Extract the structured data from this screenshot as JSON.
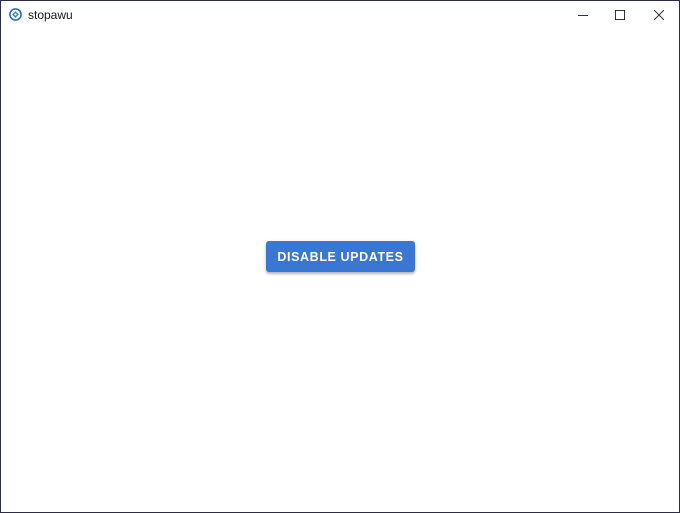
{
  "window": {
    "title": "stopawu",
    "icon": "stopawu-app-icon",
    "controls": {
      "minimize_icon": "minimize-icon",
      "maximize_icon": "maximize-icon",
      "close_icon": "close-icon"
    }
  },
  "main": {
    "primary_button_label": "DISABLE UPDATES"
  },
  "colors": {
    "accent": "#3a77d2",
    "background": "#ffffff",
    "window_border": "#2b2b4a"
  }
}
